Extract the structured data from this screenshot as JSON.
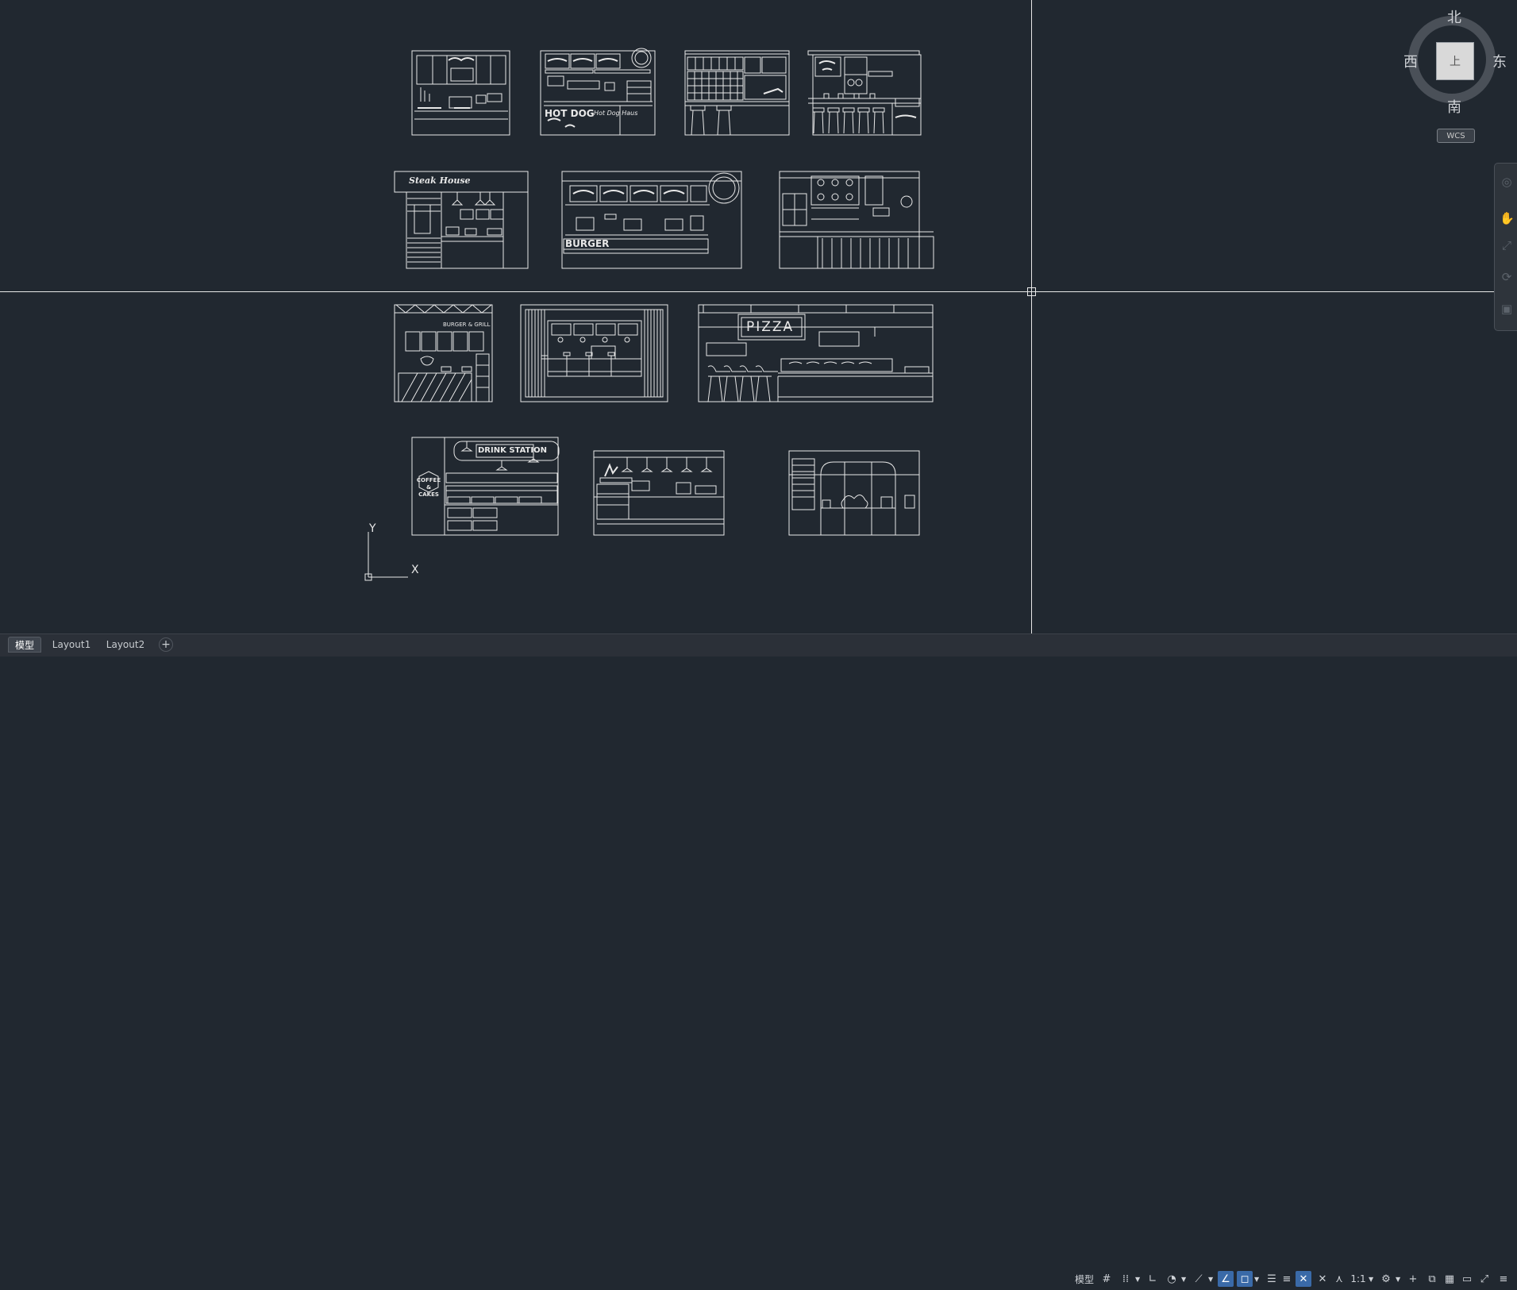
{
  "app": {
    "accent_color": "#3a6aa8",
    "background_color": "#212830",
    "line_color": "#e8e8e8"
  },
  "viewcube": {
    "north": "北",
    "south": "南",
    "east": "东",
    "west": "西",
    "face_label": "上",
    "coord_system": "WCS"
  },
  "drawing_labels": {
    "hot_dog": "HOT DOG",
    "hot_dog_sub": "Hot Dog Haus",
    "steak_house": "Steak House",
    "burger": "BURGER",
    "burger_grill": "BURGER & GRILL",
    "pizza": "PIZZA",
    "drink_station": "DRINK STATION",
    "coffee_cakes": "COFFEE & CAKES"
  },
  "ucs": {
    "x_label": "X",
    "y_label": "Y"
  },
  "tabs": [
    {
      "label": "模型",
      "active": true
    },
    {
      "label": "Layout1",
      "active": false
    },
    {
      "label": "Layout2",
      "active": false
    }
  ],
  "tab_add": "+",
  "statusbar": {
    "model_label": "模型",
    "scale_label": "1:1",
    "icons": [
      "grid-icon",
      "snap-icon",
      "ortho-icon",
      "polar-icon",
      "isodraft-icon",
      "object-snap-icon",
      "osnap-tracking-icon",
      "lineweight-icon",
      "annotation-visibility-icon",
      "auto-scale-icon",
      "workspace-gear-icon",
      "units-icon",
      "quick-properties-icon",
      "isolate-icon",
      "hardware-accel-icon",
      "clean-screen-icon",
      "customize-icon"
    ]
  }
}
